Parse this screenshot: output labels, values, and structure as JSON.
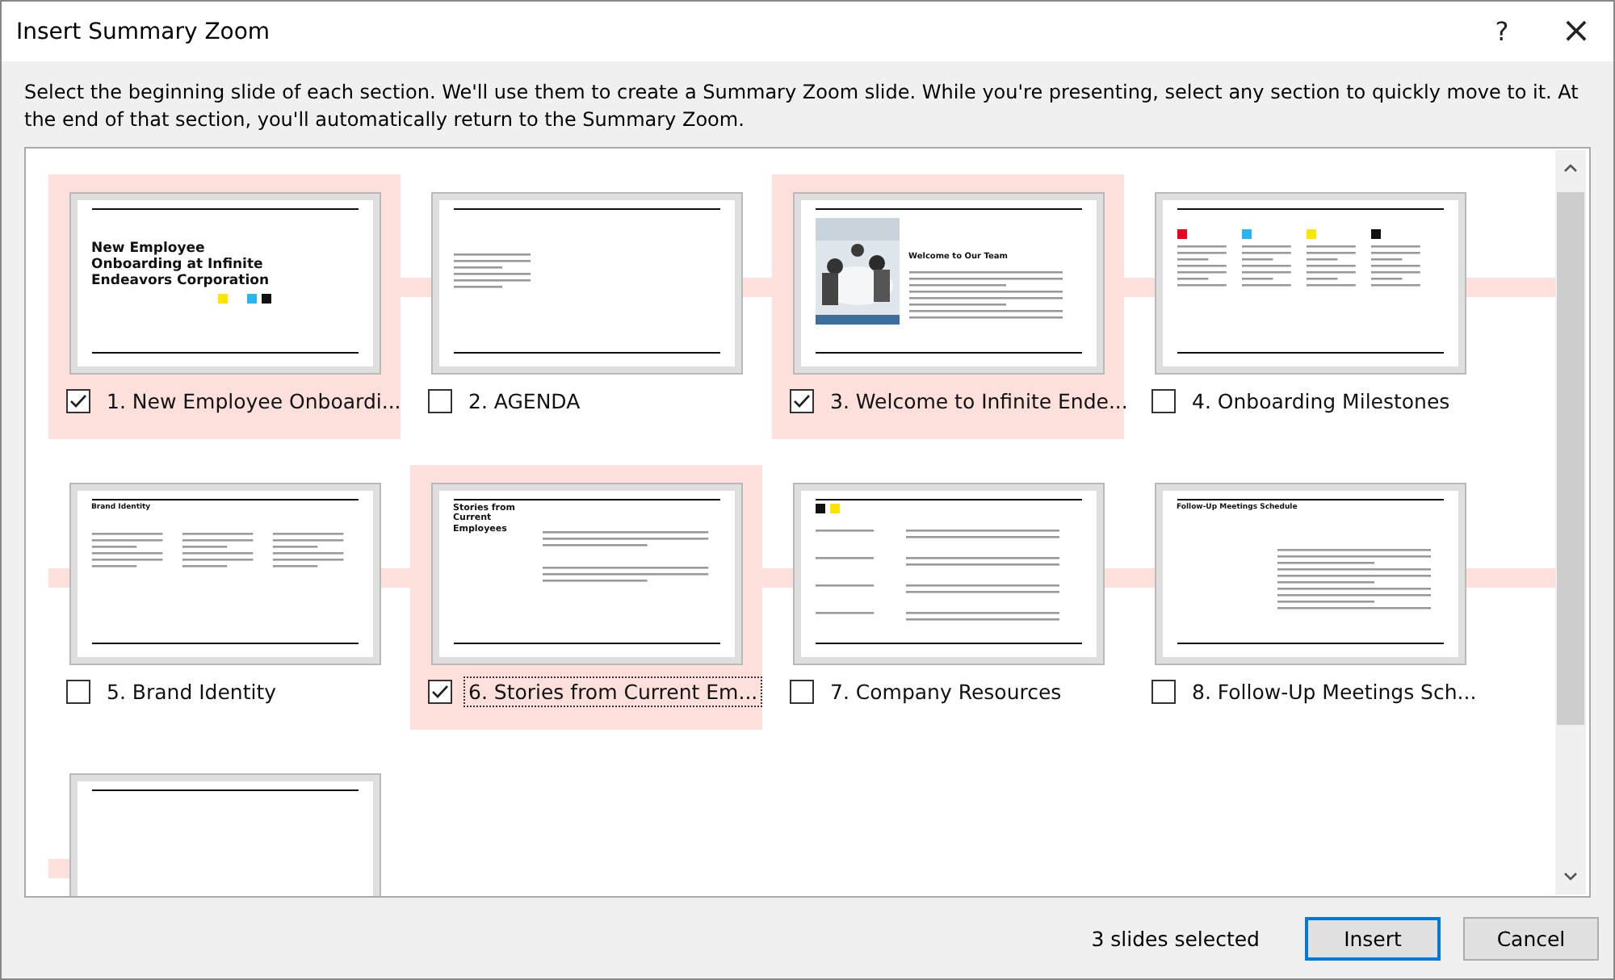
{
  "window": {
    "title": "Insert Summary Zoom",
    "help": "?",
    "close": "×"
  },
  "description": "Select the beginning slide of each section. We'll use them to create a Summary Zoom slide. While you're presenting, select any section to quickly move to it. At the end of that section, you'll automatically return to the Summary Zoom.",
  "slides": [
    {
      "label": "1. New Employee Onboardi...",
      "selected": true,
      "focused": false,
      "kind": "title",
      "title": "New Employee Onboarding at Infinite Endeavors Corporation"
    },
    {
      "label": "2. AGENDA",
      "selected": false,
      "focused": false,
      "kind": "agenda"
    },
    {
      "label": "3. Welcome to Infinite Ende...",
      "selected": true,
      "focused": false,
      "title": "Welcome to Our Team"
    },
    {
      "label": "4. Onboarding Milestones",
      "selected": false,
      "focused": false,
      "kind": "columns4"
    },
    {
      "label": "5. Brand Identity",
      "selected": false,
      "focused": false,
      "kind": "columns3",
      "title": "Brand Identity"
    },
    {
      "label": "6. Stories from Current Em...",
      "selected": true,
      "focused": true,
      "kind": "quotes",
      "title": "Stories from Current Employees"
    },
    {
      "label": "7. Company Resources",
      "selected": false,
      "focused": false,
      "kind": "table"
    },
    {
      "label": "8. Follow-Up Meetings Sch...",
      "selected": false,
      "focused": false,
      "kind": "bullets",
      "title": "Follow-Up Meetings Schedule"
    },
    {
      "kind": "blank"
    }
  ],
  "status": "3 slides selected",
  "buttons": [
    {
      "label": "Insert",
      "kind": "primary"
    },
    {
      "label": "Cancel",
      "kind": "secondary"
    }
  ]
}
